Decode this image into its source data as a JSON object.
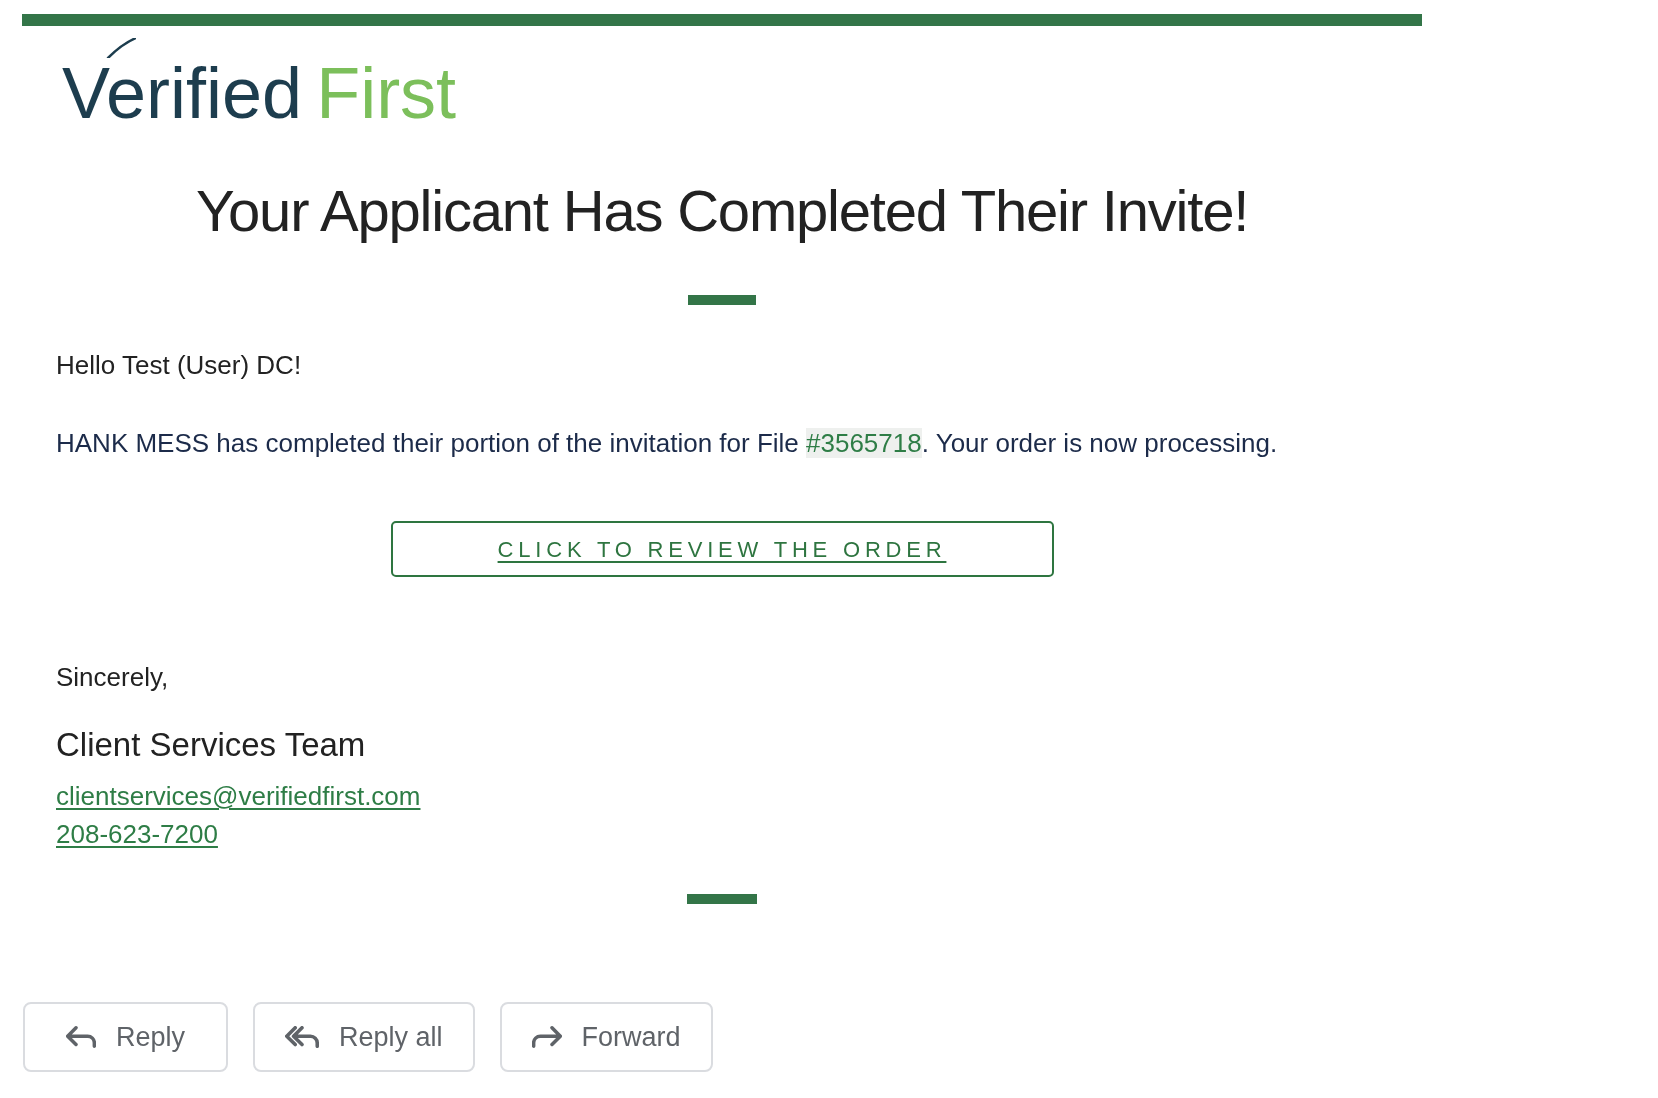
{
  "email": {
    "logo": {
      "primary": "Verified",
      "secondary": "First"
    },
    "heading": "Your Applicant Has Completed Their Invite!",
    "greeting": "Hello Test (User) DC!",
    "message": {
      "before": "HANK MESS has completed their portion of the invitation for File ",
      "file_number": "#3565718",
      "after": ". Your order is now processing."
    },
    "cta_button": "CLICK TO REVIEW THE ORDER",
    "closing": "Sincerely,",
    "signature": {
      "name": "Client Services Team",
      "email": "clientservices@verifiedfirst.com",
      "phone": "208-623-7200"
    }
  },
  "actions": [
    {
      "kind": "reply",
      "label": "Reply"
    },
    {
      "kind": "reply_all",
      "label": "Reply all"
    },
    {
      "kind": "forward",
      "label": "Forward"
    }
  ]
}
